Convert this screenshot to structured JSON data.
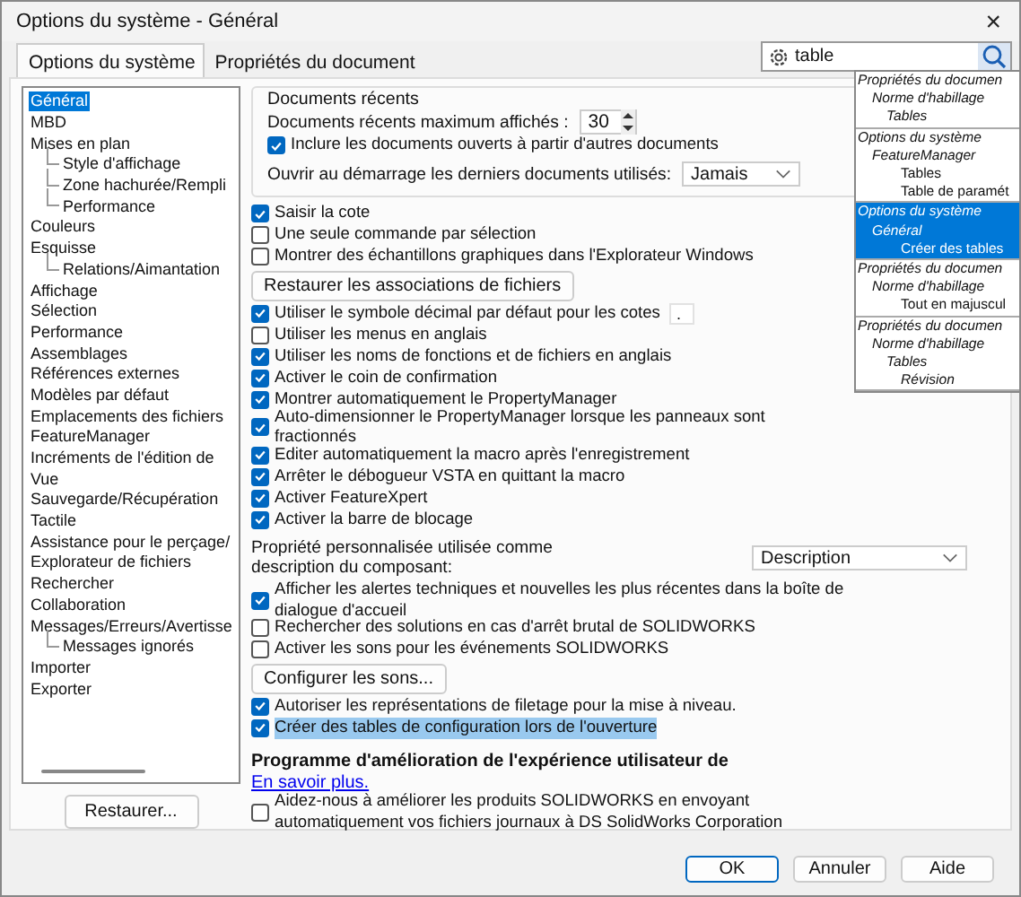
{
  "window": {
    "title": "Options du système - Général",
    "close": "×"
  },
  "tabs": [
    {
      "label": "Options du système",
      "selected": true
    },
    {
      "label": "Propriétés du document",
      "selected": false
    }
  ],
  "search": {
    "value": "table"
  },
  "search_results": [
    {
      "selected": false,
      "children": [
        {
          "label": "Propriétés du documen",
          "kind": "path",
          "children": [
            {
              "label": "Norme d'habillage",
              "kind": "path",
              "children": [
                {
                  "label": "Tables",
                  "kind": "path"
                }
              ]
            }
          ]
        }
      ]
    },
    {
      "selected": false,
      "children": [
        {
          "label": "Options du système",
          "kind": "path",
          "children": [
            {
              "label": "FeatureManager",
              "kind": "path",
              "children": [
                {
                  "label": "Tables",
                  "kind": "match"
                },
                {
                  "label": "Table de paramét",
                  "kind": "match"
                }
              ]
            }
          ]
        }
      ]
    },
    {
      "selected": true,
      "children": [
        {
          "label": "Options du système",
          "kind": "path",
          "children": [
            {
              "label": "Général",
              "kind": "path",
              "children": [
                {
                  "label": "Créer des tables",
                  "kind": "match"
                }
              ]
            }
          ]
        }
      ]
    },
    {
      "selected": false,
      "children": [
        {
          "label": "Propriétés du documen",
          "kind": "path",
          "children": [
            {
              "label": "Norme d'habillage",
              "kind": "path",
              "children": [
                {
                  "label": "Tout en majuscul",
                  "kind": "match"
                }
              ]
            }
          ]
        }
      ]
    },
    {
      "selected": false,
      "children": [
        {
          "label": "Propriétés du documen",
          "kind": "path",
          "children": [
            {
              "label": "Norme d'habillage",
              "kind": "path",
              "children": [
                {
                  "label": "Tables",
                  "kind": "path",
                  "children": [
                    {
                      "label": "Révision",
                      "kind": "path"
                    }
                  ]
                }
              ]
            }
          ]
        }
      ]
    }
  ],
  "sidebar": {
    "items": [
      {
        "label": "Général",
        "selected": true
      },
      {
        "label": "MBD",
        "selected": false
      },
      {
        "label": "Mises en plan",
        "selected": false,
        "children": [
          {
            "label": "Style d'affichage",
            "selected": false
          },
          {
            "label": "Zone hachurée/Rempli",
            "selected": false
          },
          {
            "label": "Performance",
            "selected": false
          }
        ]
      },
      {
        "label": "Couleurs",
        "selected": false
      },
      {
        "label": "Esquisse",
        "selected": false,
        "children": [
          {
            "label": "Relations/Aimantation",
            "selected": false
          }
        ]
      },
      {
        "label": "Affichage",
        "selected": false
      },
      {
        "label": "Sélection",
        "selected": false
      },
      {
        "label": "Performance",
        "selected": false
      },
      {
        "label": "Assemblages",
        "selected": false
      },
      {
        "label": "Références externes",
        "selected": false
      },
      {
        "label": "Modèles par défaut",
        "selected": false
      },
      {
        "label": "Emplacements des fichiers",
        "selected": false
      },
      {
        "label": "FeatureManager",
        "selected": false
      },
      {
        "label": "Incréments de l'édition de",
        "selected": false
      },
      {
        "label": "Vue",
        "selected": false
      },
      {
        "label": "Sauvegarde/Récupération",
        "selected": false
      },
      {
        "label": "Tactile",
        "selected": false
      },
      {
        "label": "Assistance pour le perçage/",
        "selected": false
      },
      {
        "label": "Explorateur de fichiers",
        "selected": false
      },
      {
        "label": "Rechercher",
        "selected": false
      },
      {
        "label": "Collaboration",
        "selected": false
      },
      {
        "label": "Messages/Erreurs/Avertisse",
        "selected": false,
        "children": [
          {
            "label": "Messages ignorés",
            "selected": false
          }
        ]
      },
      {
        "label": "Importer",
        "selected": false
      },
      {
        "label": "Exporter",
        "selected": false
      }
    ]
  },
  "recent_documents": {
    "title": "Documents récents",
    "max_label": "Documents récents maximum affichés :",
    "max_value": "30",
    "include": {
      "label": "Inclure les documents ouverts à partir d'autres documents",
      "checked": true
    },
    "open_label": "Ouvrir au démarrage les derniers documents utilisés:",
    "open_value": "Jamais"
  },
  "options": [
    {
      "kind": "check",
      "label": "Saisir la cote",
      "checked": true,
      "highlighted": false
    },
    {
      "kind": "check",
      "label": "Une seule commande par sélection",
      "checked": false,
      "highlighted": false
    },
    {
      "kind": "check",
      "label": "Montrer des échantillons graphiques dans l'Explorateur Windows",
      "checked": false,
      "highlighted": false
    },
    {
      "kind": "button",
      "label": "Restaurer les associations de fichiers"
    },
    {
      "kind": "check",
      "label": "Utiliser le symbole décimal par défaut pour les cotes",
      "checked": true,
      "highlighted": false,
      "field": "."
    },
    {
      "kind": "check",
      "label": "Utiliser les menus en anglais",
      "checked": false,
      "highlighted": false
    },
    {
      "kind": "check",
      "label": "Utiliser les noms de fonctions et de fichiers en anglais",
      "checked": true,
      "highlighted": false
    },
    {
      "kind": "check",
      "label": "Activer le coin de confirmation",
      "checked": true,
      "highlighted": false
    },
    {
      "kind": "check",
      "label": "Montrer automatiquement le PropertyManager",
      "checked": true,
      "highlighted": false
    },
    {
      "kind": "check",
      "label": "Auto-dimensionner le PropertyManager lorsque les panneaux sont fractionnés",
      "checked": true,
      "highlighted": false
    },
    {
      "kind": "check",
      "label": "Editer automatiquement la macro après l'enregistrement",
      "checked": true,
      "highlighted": false
    },
    {
      "kind": "check",
      "label": "Arrêter le débogueur VSTA en quittant la macro",
      "checked": true,
      "highlighted": false
    },
    {
      "kind": "check",
      "label": "Activer FeatureXpert",
      "checked": true,
      "highlighted": false
    },
    {
      "kind": "check",
      "label": "Activer la barre de blocage",
      "checked": true,
      "highlighted": false
    },
    {
      "kind": "select",
      "label": "Propriété personnalisée utilisée comme description du composant:",
      "value": "Description"
    },
    {
      "kind": "check",
      "label": "Afficher les alertes techniques et nouvelles les plus récentes dans la boîte de dialogue d'accueil",
      "checked": true,
      "highlighted": false
    },
    {
      "kind": "check",
      "label": "Rechercher des solutions en cas d'arrêt brutal de SOLIDWORKS",
      "checked": false,
      "highlighted": false
    },
    {
      "kind": "check",
      "label": "Activer les sons pour les événements SOLIDWORKS",
      "checked": false,
      "highlighted": false
    },
    {
      "kind": "button",
      "label": "Configurer les sons..."
    },
    {
      "kind": "check",
      "label": "Autoriser les représentations de filetage pour la mise à niveau.",
      "checked": true,
      "highlighted": false
    },
    {
      "kind": "check",
      "label": "Créer des tables de configuration lors de l'ouverture",
      "checked": true,
      "highlighted": true
    },
    {
      "kind": "heading",
      "label": "Programme d'amélioration de l'expérience utilisateur de"
    },
    {
      "kind": "link",
      "label": "En savoir plus."
    },
    {
      "kind": "check",
      "label": "Aidez-nous à améliorer les produits SOLIDWORKS en envoyant automatiquement vos fichiers journaux à DS SolidWorks Corporation",
      "checked": false,
      "highlighted": false
    }
  ],
  "restore_button": "Restaurer...",
  "buttons": [
    {
      "label": "OK",
      "default": true
    },
    {
      "label": "Annuler",
      "default": false
    },
    {
      "label": "Aide",
      "default": false
    }
  ]
}
